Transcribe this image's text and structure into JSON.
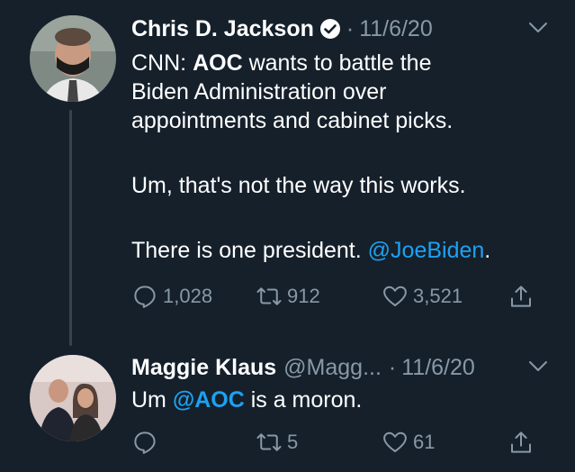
{
  "tweet1": {
    "name": "Chris D. Jackson",
    "dot": "·",
    "date": "11/6/20",
    "line1_prefix": "CNN: ",
    "line1_bold": "AOC",
    "line1_rest": " wants to battle the",
    "line2": "Biden Administration over",
    "line3": "appointments and cabinet picks.",
    "para2": "Um, that's not the way this works.",
    "para3_prefix": "There is one president. ",
    "para3_mention": "@JoeBiden",
    "para3_suffix": ".",
    "replies": "1,028",
    "retweets": "912",
    "likes": "3,521"
  },
  "tweet2": {
    "name": "Maggie Klaus",
    "handle": "@Magg...",
    "dot": "·",
    "date": "11/6/20",
    "text_prefix": "Um ",
    "text_mention": "@AOC",
    "text_suffix": " is a moron.",
    "replies": "",
    "retweets": "5",
    "likes": "61"
  },
  "colors": {
    "background": "#15202b",
    "secondary_text": "#8899a6",
    "link": "#1da1f2",
    "thread_line": "#38444d"
  }
}
